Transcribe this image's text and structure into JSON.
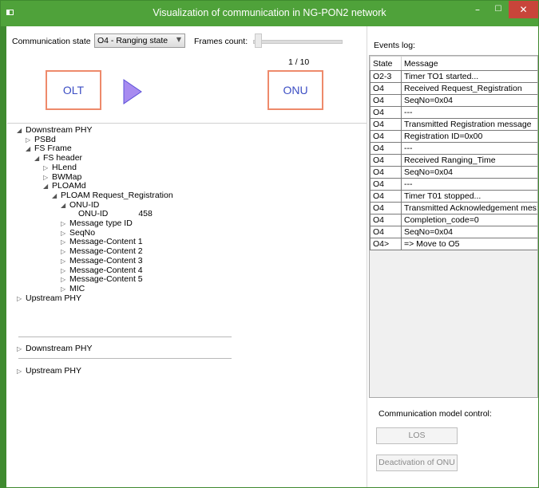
{
  "window": {
    "title": "Visualization of communication in NG-PON2 network",
    "minimize": "–",
    "maximize": "☐",
    "close": "✕"
  },
  "toolbar": {
    "state_label": "Communication state",
    "state_value": "O4 - Ranging state",
    "frames_label": "Frames count:",
    "frames_value": "1 / 10"
  },
  "diagram": {
    "olt": "OLT",
    "onu": "ONU"
  },
  "tree": [
    {
      "label": "Downstream PHY",
      "depth": 0,
      "toggle": "◢"
    },
    {
      "label": "PSBd",
      "depth": 1,
      "toggle": "▷"
    },
    {
      "label": "FS Frame",
      "depth": 1,
      "toggle": "◢"
    },
    {
      "label": "FS header",
      "depth": 2,
      "toggle": "◢"
    },
    {
      "label": "HLend",
      "depth": 3,
      "toggle": "▷"
    },
    {
      "label": "BWMap",
      "depth": 3,
      "toggle": "▷"
    },
    {
      "label": "PLOAMd",
      "depth": 3,
      "toggle": "◢"
    },
    {
      "label": "PLOAM Request_Registration",
      "depth": 4,
      "toggle": "◢"
    },
    {
      "label": "ONU-ID",
      "depth": 5,
      "toggle": "◢"
    },
    {
      "label": "ONU-ID",
      "depth": 6,
      "toggle": "",
      "value": "458"
    },
    {
      "label": "Message type ID",
      "depth": 5,
      "toggle": "▷"
    },
    {
      "label": "SeqNo",
      "depth": 5,
      "toggle": "▷"
    },
    {
      "label": "Message-Content 1",
      "depth": 5,
      "toggle": "▷"
    },
    {
      "label": "Message-Content 2",
      "depth": 5,
      "toggle": "▷"
    },
    {
      "label": "Message-Content 3",
      "depth": 5,
      "toggle": "▷"
    },
    {
      "label": "Message-Content 4",
      "depth": 5,
      "toggle": "▷"
    },
    {
      "label": "Message-Content 5",
      "depth": 5,
      "toggle": "▷"
    },
    {
      "label": "MIC",
      "depth": 5,
      "toggle": "▷"
    },
    {
      "label": "Upstream PHY",
      "depth": 0,
      "toggle": "▷"
    }
  ],
  "tree_extra": [
    {
      "label": "Downstream PHY",
      "toggle": "▷"
    },
    {
      "label": "Upstream PHY",
      "toggle": "▷"
    }
  ],
  "events": {
    "label": "Events log:",
    "headers": [
      "State",
      "Message"
    ],
    "rows": [
      [
        "O2-3",
        "Timer TO1 started..."
      ],
      [
        "O4",
        "Received Request_Registration"
      ],
      [
        "O4",
        "SeqNo=0x04"
      ],
      [
        "O4",
        "---"
      ],
      [
        "O4",
        "Transmitted Registration message"
      ],
      [
        "O4",
        "Registration ID=0x00"
      ],
      [
        "O4",
        "---"
      ],
      [
        "O4",
        "Received Ranging_Time"
      ],
      [
        "O4",
        "SeqNo=0x04"
      ],
      [
        "O4",
        "---"
      ],
      [
        "O4",
        "Timer T01 stopped..."
      ],
      [
        "O4",
        "Transmitted Acknowledgement mes:"
      ],
      [
        "O4",
        "Completion_code=0"
      ],
      [
        "O4",
        "SeqNo=0x04"
      ],
      [
        "O4>",
        "=> Move to O5"
      ]
    ]
  },
  "control": {
    "label": "Communication model control:",
    "los": "LOS",
    "deactivate": "Deactivation of ONU"
  },
  "colors": {
    "titlebar": "#4fa23a",
    "box_border": "#ee8a6b",
    "arrow": "#a78bf0",
    "box_text": "#3c4ec4"
  }
}
